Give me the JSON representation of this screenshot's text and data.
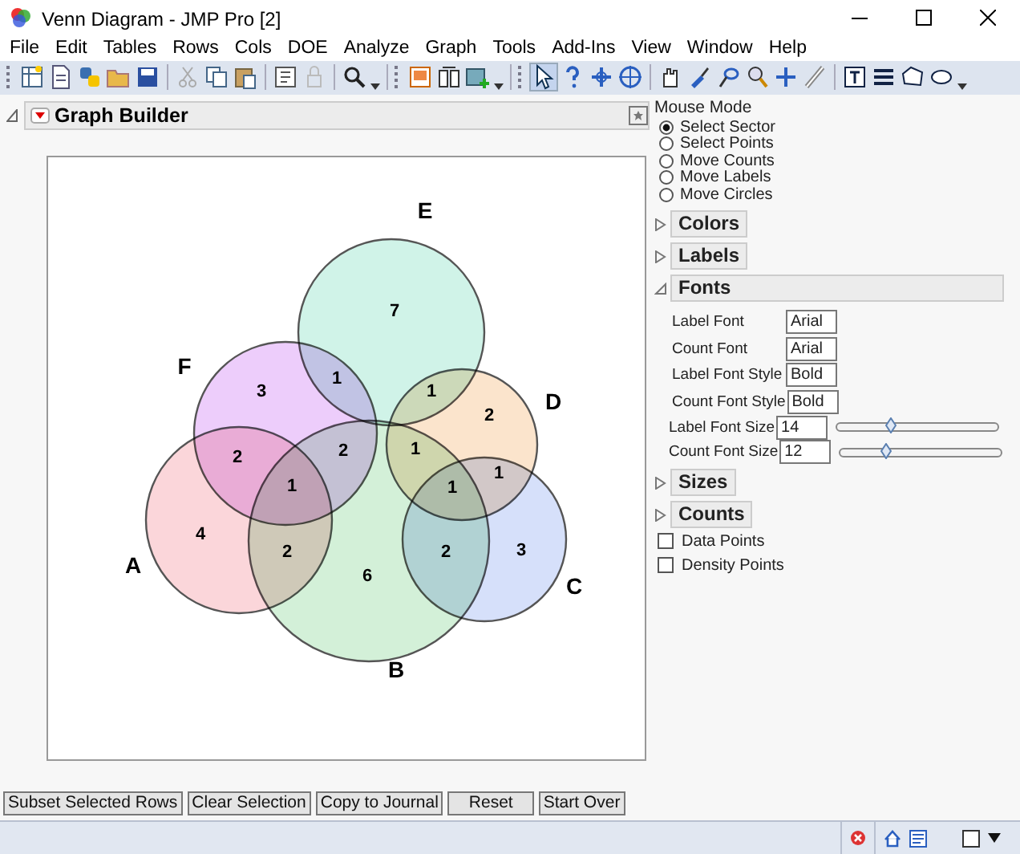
{
  "window": {
    "title": "Venn Diagram - JMP Pro [2]"
  },
  "menu": [
    "File",
    "Edit",
    "Tables",
    "Rows",
    "Cols",
    "DOE",
    "Analyze",
    "Graph",
    "Tools",
    "Add-Ins",
    "View",
    "Window",
    "Help"
  ],
  "report": {
    "title": "Graph Builder",
    "venn": {
      "sets": [
        {
          "label": "A",
          "color": "#fbd6da"
        },
        {
          "label": "B",
          "color": "#d3f0d8"
        },
        {
          "label": "C",
          "color": "#d6e0fa"
        },
        {
          "label": "D",
          "color": "#fbe4cc"
        },
        {
          "label": "E",
          "color": "#d0f3e8"
        },
        {
          "label": "F",
          "color": "#edcdfb"
        }
      ],
      "counts": [
        "7",
        "1",
        "3",
        "1",
        "2",
        "2",
        "2",
        "1",
        "1",
        "1",
        "1",
        "4",
        "2",
        "6",
        "2",
        "3"
      ]
    }
  },
  "panel": {
    "mouse_mode": {
      "title": "Mouse Mode",
      "options": [
        {
          "label": "Select Sector",
          "selected": true
        },
        {
          "label": "Select Points",
          "selected": false
        },
        {
          "label": "Move Counts",
          "selected": false
        },
        {
          "label": "Move Labels",
          "selected": false
        },
        {
          "label": "Move Circles",
          "selected": false
        }
      ]
    },
    "sections": [
      {
        "title": "Colors",
        "expanded": false
      },
      {
        "title": "Labels",
        "expanded": false
      },
      {
        "title": "Fonts",
        "expanded": true,
        "fields": [
          {
            "label": "Label Font",
            "value": "Arial"
          },
          {
            "label": "Count Font",
            "value": "Arial"
          },
          {
            "label": "Label Font Style",
            "value": "Bold"
          },
          {
            "label": "Count Font Style",
            "value": "Bold"
          }
        ],
        "sliders": [
          {
            "label": "Label Font Size",
            "value": "14",
            "level": 0.34
          },
          {
            "label": "Count Font Size",
            "value": "12",
            "level": 0.29
          }
        ]
      },
      {
        "title": "Sizes",
        "expanded": false
      },
      {
        "title": "Counts",
        "expanded": false
      }
    ],
    "checkboxes": [
      {
        "label": "Data Points",
        "checked": false
      },
      {
        "label": "Density Points",
        "checked": false
      }
    ]
  },
  "buttons": [
    "Subset Selected Rows",
    "Clear Selection",
    "Copy to Journal",
    "Reset",
    "Start Over"
  ]
}
